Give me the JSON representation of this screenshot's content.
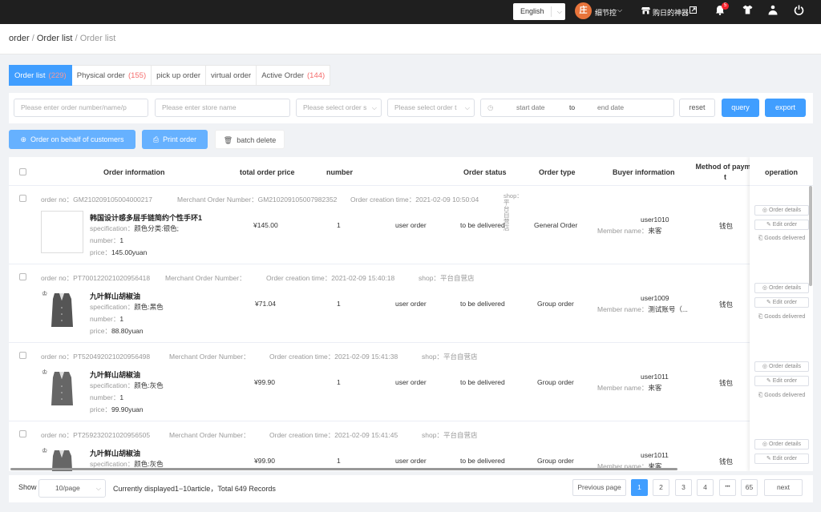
{
  "topbar": {
    "language": "English",
    "avatar_char": "庄",
    "user_name": "细节控",
    "shop_name": "购日的神器",
    "notification_count": "5"
  },
  "breadcrumb": {
    "root": "order",
    "level1": "Order list",
    "level2": "Order list"
  },
  "tabs": [
    {
      "label": "Order list",
      "count": "(229)"
    },
    {
      "label": "Physical order",
      "count": "(155)"
    },
    {
      "label": "pick up order",
      "count": ""
    },
    {
      "label": "virtual order",
      "count": ""
    },
    {
      "label": "Active Order",
      "count": "(144)"
    }
  ],
  "filters": {
    "order_search_placeholder": "Please enter order number/name/p",
    "store_placeholder": "Please enter store name",
    "status_placeholder": "Please select order s",
    "type_placeholder": "Please select order t",
    "start_date": "start date",
    "to": "to",
    "end_date": "end date",
    "reset": "reset",
    "query": "query",
    "export": "export"
  },
  "actions": {
    "behalf": "Order on behalf of customers",
    "print": "Print order",
    "batch_delete": "batch delete"
  },
  "columns": {
    "info": "Order information",
    "price": "total order price",
    "number": "number",
    "status": "Order status",
    "type": "Order type",
    "buyer": "Buyer information",
    "payment": "Method of payme\nt",
    "operation": "operation"
  },
  "labels": {
    "order_no": "order no：",
    "merchant": "Merchant Order Number：",
    "created": "Order creation time：",
    "shop": "shop：",
    "spec": "specification：",
    "number": "number：",
    "price": "price：",
    "member": "Member name：",
    "details": "Order details",
    "edit": "Edit order",
    "delivered": "Goods delivered"
  },
  "rows": [
    {
      "order_no": "GM210209105004000217",
      "merchant_no": "GM210209105007982352",
      "time": "2021-02-09 10:50:04",
      "shop": "平台自营店",
      "product": "韩国设计感多层手链简约个性手环1",
      "spec": "颜色分类:银色;",
      "qty": "1",
      "unit_price": "145.00yuan",
      "total": "¥145.00",
      "number": "1",
      "source": "user order",
      "status": "to be delivered",
      "type": "General Order",
      "user": "user1010",
      "member": "来客",
      "payment": "钱包"
    },
    {
      "order_no": "PT700122021020956418",
      "merchant_no": "",
      "time": "2021-02-09 15:40:18",
      "shop": "平台自营店",
      "product": "九叶鲜山胡椒油",
      "spec": "颜色:黑色",
      "qty": "1",
      "unit_price": "88.80yuan",
      "total": "¥71.04",
      "number": "1",
      "source": "user order",
      "status": "to be delivered",
      "type": "Group order",
      "user": "user1009",
      "member": "测试账号（...",
      "payment": "钱包"
    },
    {
      "order_no": "PT520492021020956498",
      "merchant_no": "",
      "time": "2021-02-09 15:41:38",
      "shop": "平台自营店",
      "product": "九叶鲜山胡椒油",
      "spec": "颜色:灰色",
      "qty": "1",
      "unit_price": "99.90yuan",
      "total": "¥99.90",
      "number": "1",
      "source": "user order",
      "status": "to be delivered",
      "type": "Group order",
      "user": "user1011",
      "member": "来客",
      "payment": "钱包"
    },
    {
      "order_no": "PT259232021020956505",
      "merchant_no": "",
      "time": "2021-02-09 15:41:45",
      "shop": "平台自营店",
      "product": "九叶鲜山胡椒油",
      "spec": "颜色:灰色",
      "qty": "",
      "unit_price": "",
      "total": "¥99.90",
      "number": "1",
      "source": "user order",
      "status": "to be delivered",
      "type": "Group order",
      "user": "user1011",
      "member": "来客",
      "payment": "钱包"
    }
  ],
  "pagination": {
    "show": "Show",
    "page_size": "10/page",
    "summary": "Currently displayed1−10article，Total 649 Records",
    "prev": "Previous page",
    "pages": [
      "1",
      "2",
      "3",
      "4",
      "•••",
      "65"
    ],
    "next": "next",
    "current_page": 1
  },
  "colors": {
    "primary": "#409eff",
    "topbar": "#1f1f1f",
    "count": "#f56c6c"
  }
}
